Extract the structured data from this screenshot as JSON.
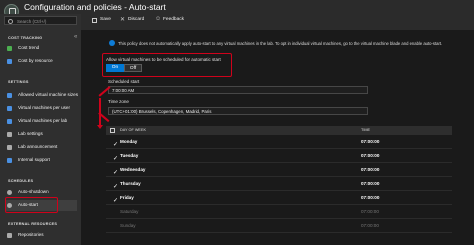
{
  "window": {
    "title": "Configuration and policies - Auto-start",
    "subtitle": "DevTest Lab"
  },
  "sidebar": {
    "search_placeholder": "Search (Ctrl+/)",
    "sections": {
      "cost_tracking": "COST TRACKING",
      "settings": "SETTINGS",
      "schedules": "SCHEDULES",
      "external_resources": "EXTERNAL RESOURCES"
    },
    "items": [
      {
        "label": "Cost trend",
        "icon": "cost-trend-icon",
        "color": "#4caf50"
      },
      {
        "label": "Cost by resource",
        "icon": "cost-resource-icon",
        "color": "#4a90e2"
      },
      {
        "label": "Allowed virtual machine sizes",
        "icon": "vm-size-icon",
        "color": "#4a90e2"
      },
      {
        "label": "Virtual machines per user",
        "icon": "vm-user-icon",
        "color": "#4a90e2"
      },
      {
        "label": "Virtual machines per lab",
        "icon": "vm-lab-icon",
        "color": "#4a90e2"
      },
      {
        "label": "Lab settings",
        "icon": "lab-settings-icon",
        "color": "#aaaaaa"
      },
      {
        "label": "Lab announcement",
        "icon": "announcement-icon",
        "color": "#aaaaaa"
      },
      {
        "label": "Internal support",
        "icon": "support-icon",
        "color": "#4a90e2"
      },
      {
        "label": "Auto-shutdown",
        "icon": "clock-icon",
        "color": "#aaaaaa"
      },
      {
        "label": "Auto-start",
        "icon": "clock-icon",
        "color": "#aaaaaa"
      },
      {
        "label": "Repositories",
        "icon": "repository-icon",
        "color": "#aaaaaa"
      }
    ]
  },
  "toolbar": {
    "save": "Save",
    "discard": "Discard",
    "feedback": "Feedback"
  },
  "main": {
    "info": "This policy does not automatically apply auto-start to any virtual machines in the lab. To opt in individual virtual machines, go to the virtual machine blade and enable auto-start.",
    "allow_label": "Allow virtual machines to be scheduled for automatic start",
    "toggle_on": "On",
    "toggle_off": "Off",
    "scheduled_label": "Scheduled start",
    "scheduled_value": "7:00:00 AM",
    "timezone_label": "Time zone",
    "timezone_value": "(UTC+01:00) Brussels, Copenhagen, Madrid, Paris",
    "table": {
      "headers": {
        "day": "DAY OF WEEK",
        "time": "TIME"
      },
      "rows": [
        {
          "day": "Monday",
          "time": "07:00:00",
          "checked": true
        },
        {
          "day": "Tuesday",
          "time": "07:00:00",
          "checked": true
        },
        {
          "day": "Wednesday",
          "time": "07:00:00",
          "checked": true
        },
        {
          "day": "Thursday",
          "time": "07:00:00",
          "checked": true
        },
        {
          "day": "Friday",
          "time": "07:00:00",
          "checked": true
        },
        {
          "day": "Saturday",
          "time": "07:00:00",
          "checked": false
        },
        {
          "day": "Sunday",
          "time": "07:00:00",
          "checked": false
        }
      ]
    }
  },
  "colors": {
    "accent": "#0078d4",
    "highlight": "#d0021b"
  }
}
